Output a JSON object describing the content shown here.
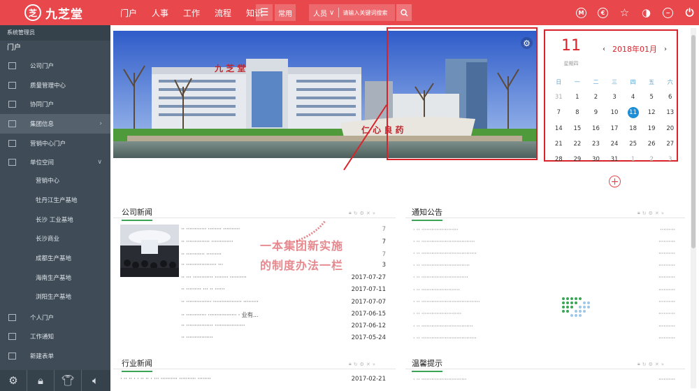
{
  "topbar": {
    "logo_mark": "芝",
    "logo_text": "九芝堂",
    "nav": [
      "门户",
      "人事",
      "工作",
      "流程",
      "知识"
    ],
    "common_label": "常用",
    "search_scope": "人员",
    "search_placeholder": "请输入关键词搜索"
  },
  "sidebar": {
    "user_label": "系统管理员",
    "section": "门户",
    "items": [
      {
        "label": "公司门户"
      },
      {
        "label": "质量管理中心"
      },
      {
        "label": "协同门户"
      },
      {
        "label": "集团信息"
      },
      {
        "label": "营销中心门户"
      },
      {
        "label": "单位空间"
      }
    ],
    "sub_items": [
      "营销中心",
      "牡丹江生产基地",
      "长沙 工业基地",
      "长沙商业",
      "成都生产基地",
      "海南生产基地",
      "浏阳生产基地"
    ],
    "bottom_items": [
      {
        "label": "个人门户"
      },
      {
        "label": "工作通知"
      },
      {
        "label": "新建表单"
      }
    ]
  },
  "calendar": {
    "day": "11",
    "weekday": "星期四",
    "month_label": "2018年01月",
    "weekday_headers": [
      "日",
      "一",
      "二",
      "三",
      "四",
      "五",
      "六"
    ],
    "weeks": [
      [
        "31",
        "1",
        "2",
        "3",
        "4",
        "5",
        "6"
      ],
      [
        "7",
        "8",
        "9",
        "10",
        "11",
        "12",
        "13"
      ],
      [
        "14",
        "15",
        "16",
        "17",
        "18",
        "19",
        "20"
      ],
      [
        "21",
        "22",
        "23",
        "24",
        "25",
        "26",
        "27"
      ],
      [
        "28",
        "29",
        "30",
        "31",
        "1",
        "2",
        "3"
      ]
    ]
  },
  "company_news": {
    "title": "公司新闻",
    "dates": [
      "7",
      "7",
      "3",
      "2017-07-27",
      "2017-07-11",
      "2017-07-07",
      "2017-06-15",
      "2017-06-12",
      "2017-05-24"
    ],
    "snippet_6": "业有...",
    "snippet_7": "提..."
  },
  "notice": {
    "title": "通知公告"
  },
  "industry_news": {
    "title": "行业新闻",
    "dates": [
      "2017-02-21"
    ]
  },
  "warm_tips": {
    "title": "温馨提示"
  },
  "overlay": {
    "line1": "一本集团新实施",
    "line2": "的制度办法一栏"
  }
}
